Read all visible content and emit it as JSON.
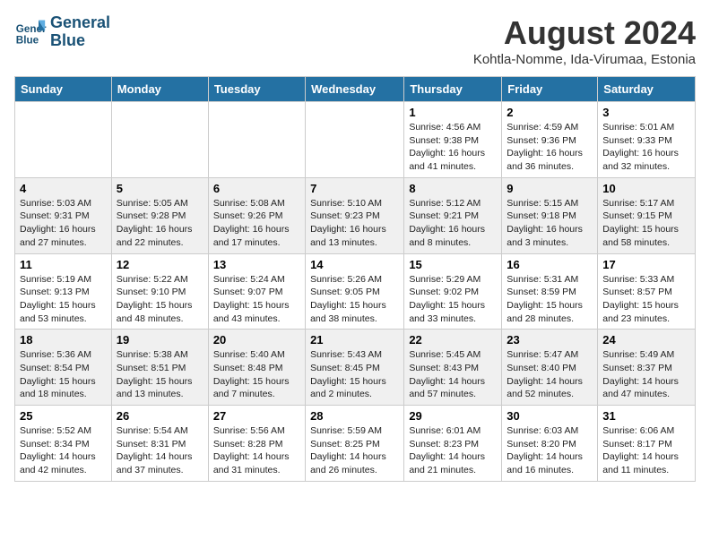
{
  "header": {
    "logo_line1": "General",
    "logo_line2": "Blue",
    "month_year": "August 2024",
    "location": "Kohtla-Nomme, Ida-Virumaa, Estonia"
  },
  "weekdays": [
    "Sunday",
    "Monday",
    "Tuesday",
    "Wednesday",
    "Thursday",
    "Friday",
    "Saturday"
  ],
  "weeks": [
    [
      {
        "day": "",
        "info": ""
      },
      {
        "day": "",
        "info": ""
      },
      {
        "day": "",
        "info": ""
      },
      {
        "day": "",
        "info": ""
      },
      {
        "day": "1",
        "info": "Sunrise: 4:56 AM\nSunset: 9:38 PM\nDaylight: 16 hours\nand 41 minutes."
      },
      {
        "day": "2",
        "info": "Sunrise: 4:59 AM\nSunset: 9:36 PM\nDaylight: 16 hours\nand 36 minutes."
      },
      {
        "day": "3",
        "info": "Sunrise: 5:01 AM\nSunset: 9:33 PM\nDaylight: 16 hours\nand 32 minutes."
      }
    ],
    [
      {
        "day": "4",
        "info": "Sunrise: 5:03 AM\nSunset: 9:31 PM\nDaylight: 16 hours\nand 27 minutes."
      },
      {
        "day": "5",
        "info": "Sunrise: 5:05 AM\nSunset: 9:28 PM\nDaylight: 16 hours\nand 22 minutes."
      },
      {
        "day": "6",
        "info": "Sunrise: 5:08 AM\nSunset: 9:26 PM\nDaylight: 16 hours\nand 17 minutes."
      },
      {
        "day": "7",
        "info": "Sunrise: 5:10 AM\nSunset: 9:23 PM\nDaylight: 16 hours\nand 13 minutes."
      },
      {
        "day": "8",
        "info": "Sunrise: 5:12 AM\nSunset: 9:21 PM\nDaylight: 16 hours\nand 8 minutes."
      },
      {
        "day": "9",
        "info": "Sunrise: 5:15 AM\nSunset: 9:18 PM\nDaylight: 16 hours\nand 3 minutes."
      },
      {
        "day": "10",
        "info": "Sunrise: 5:17 AM\nSunset: 9:15 PM\nDaylight: 15 hours\nand 58 minutes."
      }
    ],
    [
      {
        "day": "11",
        "info": "Sunrise: 5:19 AM\nSunset: 9:13 PM\nDaylight: 15 hours\nand 53 minutes."
      },
      {
        "day": "12",
        "info": "Sunrise: 5:22 AM\nSunset: 9:10 PM\nDaylight: 15 hours\nand 48 minutes."
      },
      {
        "day": "13",
        "info": "Sunrise: 5:24 AM\nSunset: 9:07 PM\nDaylight: 15 hours\nand 43 minutes."
      },
      {
        "day": "14",
        "info": "Sunrise: 5:26 AM\nSunset: 9:05 PM\nDaylight: 15 hours\nand 38 minutes."
      },
      {
        "day": "15",
        "info": "Sunrise: 5:29 AM\nSunset: 9:02 PM\nDaylight: 15 hours\nand 33 minutes."
      },
      {
        "day": "16",
        "info": "Sunrise: 5:31 AM\nSunset: 8:59 PM\nDaylight: 15 hours\nand 28 minutes."
      },
      {
        "day": "17",
        "info": "Sunrise: 5:33 AM\nSunset: 8:57 PM\nDaylight: 15 hours\nand 23 minutes."
      }
    ],
    [
      {
        "day": "18",
        "info": "Sunrise: 5:36 AM\nSunset: 8:54 PM\nDaylight: 15 hours\nand 18 minutes."
      },
      {
        "day": "19",
        "info": "Sunrise: 5:38 AM\nSunset: 8:51 PM\nDaylight: 15 hours\nand 13 minutes."
      },
      {
        "day": "20",
        "info": "Sunrise: 5:40 AM\nSunset: 8:48 PM\nDaylight: 15 hours\nand 7 minutes."
      },
      {
        "day": "21",
        "info": "Sunrise: 5:43 AM\nSunset: 8:45 PM\nDaylight: 15 hours\nand 2 minutes."
      },
      {
        "day": "22",
        "info": "Sunrise: 5:45 AM\nSunset: 8:43 PM\nDaylight: 14 hours\nand 57 minutes."
      },
      {
        "day": "23",
        "info": "Sunrise: 5:47 AM\nSunset: 8:40 PM\nDaylight: 14 hours\nand 52 minutes."
      },
      {
        "day": "24",
        "info": "Sunrise: 5:49 AM\nSunset: 8:37 PM\nDaylight: 14 hours\nand 47 minutes."
      }
    ],
    [
      {
        "day": "25",
        "info": "Sunrise: 5:52 AM\nSunset: 8:34 PM\nDaylight: 14 hours\nand 42 minutes."
      },
      {
        "day": "26",
        "info": "Sunrise: 5:54 AM\nSunset: 8:31 PM\nDaylight: 14 hours\nand 37 minutes."
      },
      {
        "day": "27",
        "info": "Sunrise: 5:56 AM\nSunset: 8:28 PM\nDaylight: 14 hours\nand 31 minutes."
      },
      {
        "day": "28",
        "info": "Sunrise: 5:59 AM\nSunset: 8:25 PM\nDaylight: 14 hours\nand 26 minutes."
      },
      {
        "day": "29",
        "info": "Sunrise: 6:01 AM\nSunset: 8:23 PM\nDaylight: 14 hours\nand 21 minutes."
      },
      {
        "day": "30",
        "info": "Sunrise: 6:03 AM\nSunset: 8:20 PM\nDaylight: 14 hours\nand 16 minutes."
      },
      {
        "day": "31",
        "info": "Sunrise: 6:06 AM\nSunset: 8:17 PM\nDaylight: 14 hours\nand 11 minutes."
      }
    ]
  ]
}
